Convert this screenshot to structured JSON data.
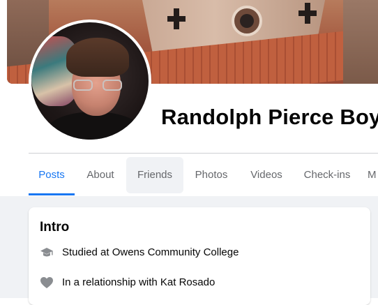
{
  "profile": {
    "name": "Randolph Pierce Boy"
  },
  "tabs": [
    {
      "label": "Posts"
    },
    {
      "label": "About"
    },
    {
      "label": "Friends"
    },
    {
      "label": "Photos"
    },
    {
      "label": "Videos"
    },
    {
      "label": "Check-ins"
    },
    {
      "label": "M"
    }
  ],
  "active_tab": "Posts",
  "hovered_tab": "Friends",
  "intro": {
    "title": "Intro",
    "education": {
      "prefix": "Studied at ",
      "link": "Owens Community College",
      "icon": "graduation-cap-icon"
    },
    "relationship": {
      "prefix": "In a relationship with ",
      "link": "Kat Rosado",
      "icon": "heart-icon"
    }
  },
  "colors": {
    "accent": "#1877f2",
    "tab_text": "#65676b",
    "feed_background": "#f0f2f5",
    "icon_gray": "#8a8d91"
  }
}
